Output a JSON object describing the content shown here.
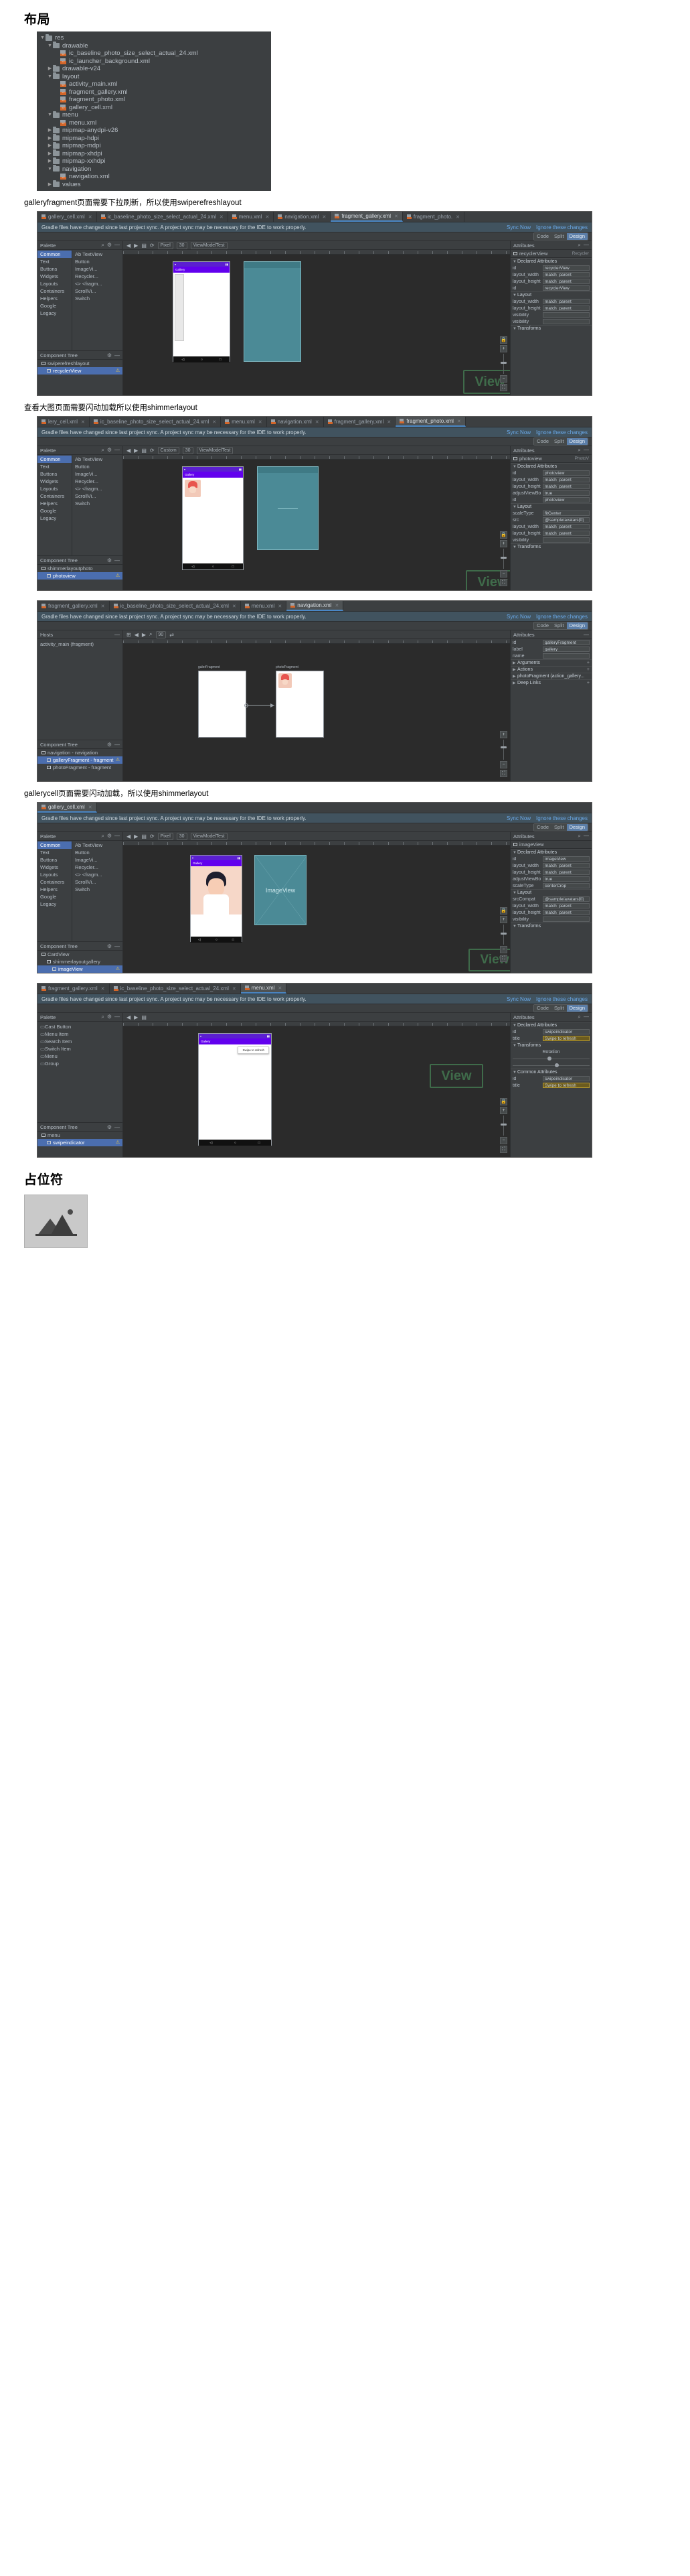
{
  "sections": {
    "layout_title": "布局",
    "caption1": "galleryfragment页面需要下拉刷新，所以使用swiperefreshlayout",
    "caption2": "查看大图页面需要闪动加载所以使用shimmerlayout",
    "caption3": "gallerycell页面需要闪动加载，所以使用shimmerlayout",
    "placeholder_title": "占位符"
  },
  "filetree": [
    {
      "depth": 0,
      "arrow": "▼",
      "icon": "folder-res",
      "label": "res"
    },
    {
      "depth": 1,
      "arrow": "▼",
      "icon": "folder",
      "label": "drawable"
    },
    {
      "depth": 2,
      "arrow": "",
      "icon": "xml",
      "label": "ic_baseline_photo_size_select_actual_24.xml"
    },
    {
      "depth": 2,
      "arrow": "",
      "icon": "xml",
      "label": "ic_launcher_background.xml"
    },
    {
      "depth": 1,
      "arrow": "▶",
      "icon": "folder",
      "label": "drawable-v24"
    },
    {
      "depth": 1,
      "arrow": "▼",
      "icon": "folder",
      "label": "layout"
    },
    {
      "depth": 2,
      "arrow": "",
      "icon": "xml",
      "label": "activity_main.xml"
    },
    {
      "depth": 2,
      "arrow": "",
      "icon": "xml",
      "label": "fragment_gallery.xml"
    },
    {
      "depth": 2,
      "arrow": "",
      "icon": "xml",
      "label": "fragment_photo.xml"
    },
    {
      "depth": 2,
      "arrow": "",
      "icon": "xml",
      "label": "gallery_cell.xml"
    },
    {
      "depth": 1,
      "arrow": "▼",
      "icon": "folder",
      "label": "menu"
    },
    {
      "depth": 2,
      "arrow": "",
      "icon": "xml",
      "label": "menu.xml"
    },
    {
      "depth": 1,
      "arrow": "▶",
      "icon": "folder",
      "label": "mipmap-anydpi-v26"
    },
    {
      "depth": 1,
      "arrow": "▶",
      "icon": "folder",
      "label": "mipmap-hdpi"
    },
    {
      "depth": 1,
      "arrow": "▶",
      "icon": "folder",
      "label": "mipmap-mdpi"
    },
    {
      "depth": 1,
      "arrow": "▶",
      "icon": "folder",
      "label": "mipmap-xhdpi"
    },
    {
      "depth": 1,
      "arrow": "▶",
      "icon": "folder",
      "label": "mipmap-xxhdpi"
    },
    {
      "depth": 1,
      "arrow": "▼",
      "icon": "folder",
      "label": "navigation"
    },
    {
      "depth": 2,
      "arrow": "",
      "icon": "xml",
      "label": "navigation.xml"
    },
    {
      "depth": 1,
      "arrow": "▶",
      "icon": "folder",
      "label": "values"
    }
  ],
  "common": {
    "sync_banner_text": "Gradle files have changed since last project sync. A project sync may be necessary for the IDE to work properly.",
    "sync_now": "Sync Now",
    "ignore_changes": "Ignore these changes",
    "code": "Code",
    "split": "Split",
    "design": "Design",
    "palette_title": "Palette",
    "component_tree_title": "Component Tree",
    "attributes_title": "Attributes",
    "declared_attributes": "Declared Attributes",
    "layout_group": "Layout",
    "transforms_group": "Transforms",
    "common_attributes": "Common Attributes",
    "palette_categories": [
      "Common",
      "Text",
      "Buttons",
      "Widgets",
      "Layouts",
      "Containers",
      "Helpers",
      "Google",
      "Legacy"
    ],
    "palette_items": [
      "Ab TextView",
      "Button",
      "ImageVi...",
      "Recycler...",
      "<> <fragm...",
      "ScrollVi...",
      "Switch"
    ],
    "view_watermark": "View"
  },
  "panel1": {
    "tabs": [
      {
        "label": "gallery_cell.xml",
        "active": false
      },
      {
        "label": "ic_baseline_photo_size_select_actual_24.xml",
        "active": false
      },
      {
        "label": "menu.xml",
        "active": false
      },
      {
        "label": "navigation.xml",
        "active": false
      },
      {
        "label": "fragment_gallery.xml",
        "active": true
      },
      {
        "label": "fragment_photo.",
        "active": false
      }
    ],
    "toolbar": {
      "device": "Pixel",
      "api": "30",
      "theme": "ViewModelTest"
    },
    "selected_component": "recyclerView",
    "component_tree": [
      {
        "label": "swiperefreshlayout",
        "sel": false,
        "depth": 0
      },
      {
        "label": "recyclerView",
        "sel": true,
        "depth": 1
      }
    ],
    "attr_header_name": "recyclerView",
    "attr_header_type": "Recycler",
    "attrs": [
      {
        "k": "id",
        "v": "recyclerView",
        "hl": false
      },
      {
        "k": "layout_width",
        "v": "match_parent",
        "hl": false
      },
      {
        "k": "layout_height",
        "v": "match_parent",
        "hl": false
      },
      {
        "k": "id",
        "v": "recyclerView",
        "hl": false
      },
      {
        "k": "layout_width",
        "v": "match_parent",
        "hl": false
      },
      {
        "k": "layout_height",
        "v": "match_parent",
        "hl": false
      },
      {
        "k": "visibility",
        "v": "",
        "hl": false
      },
      {
        "k": "visibility",
        "v": "",
        "hl": false
      }
    ],
    "phone_title": "Gallery",
    "blueprint_label": "View"
  },
  "panel2": {
    "tabs": [
      {
        "label": "lery_cell.xml",
        "active": false
      },
      {
        "label": "ic_baseline_photo_size_select_actual_24.xml",
        "active": false
      },
      {
        "label": "menu.xml",
        "active": false
      },
      {
        "label": "navigation.xml",
        "active": false
      },
      {
        "label": "fragment_gallery.xml",
        "active": false
      },
      {
        "label": "fragment_photo.xml",
        "active": true
      }
    ],
    "toolbar": {
      "device": "Custom",
      "api": "30",
      "theme": "ViewModelTest"
    },
    "selected_component": "photoview",
    "component_tree": [
      {
        "label": "shimmerlayoutphoto",
        "sel": false,
        "depth": 0
      },
      {
        "label": "photoview",
        "sel": true,
        "depth": 1
      }
    ],
    "attr_header_name": "photoview",
    "attr_header_type": "PhotoV",
    "attrs": [
      {
        "k": "id",
        "v": "photoview",
        "hl": false
      },
      {
        "k": "layout_width",
        "v": "match_parent",
        "hl": false
      },
      {
        "k": "layout_height",
        "v": "match_parent",
        "hl": false
      },
      {
        "k": "adjustViewBo...",
        "v": "true",
        "hl": false
      },
      {
        "k": "id",
        "v": "photoview",
        "hl": false
      },
      {
        "k": "scaleType",
        "v": "fitCenter",
        "hl": false
      },
      {
        "k": "src",
        "v": "@sample/avatars[0]",
        "hl": false
      },
      {
        "k": "layout_width",
        "v": "match_parent",
        "hl": false
      },
      {
        "k": "layout_height",
        "v": "match_parent",
        "hl": false
      },
      {
        "k": "visibility",
        "v": "",
        "hl": false
      }
    ],
    "phone_title": "Gallery",
    "blueprint_label": "View"
  },
  "panel3": {
    "tabs": [
      {
        "label": "fragment_gallery.xml",
        "active": false
      },
      {
        "label": "ic_baseline_photo_size_select_actual_24.xml",
        "active": false
      },
      {
        "label": "menu.xml",
        "active": false
      },
      {
        "label": "navigation.xml",
        "active": true
      }
    ],
    "hosts_title": "Hosts",
    "host_item": "activity_main (fragment)",
    "component_tree": [
      {
        "label": "navigation - navigation",
        "sel": false,
        "depth": 0
      },
      {
        "label": "galleryFragment - fragment",
        "sel": true,
        "depth": 1
      },
      {
        "label": "photoFragment - fragment",
        "sel": false,
        "depth": 1
      }
    ],
    "graph_nodes": [
      {
        "label": "galerFragment"
      },
      {
        "label": "photoFragment"
      }
    ],
    "attr_header_name": "galleryFragment",
    "attr_header_type": "Fragment",
    "attrs": [
      {
        "k": "id",
        "v": "galleryFragment",
        "hl": false
      },
      {
        "k": "label",
        "v": "gallery",
        "hl": false
      },
      {
        "k": "name",
        "v": "",
        "hl": false
      }
    ],
    "groups": [
      {
        "label": "Arguments",
        "plus": true
      },
      {
        "label": "Actions",
        "plus": true
      },
      {
        "label": "photoFragment  (action_gallery...",
        "plus": false
      },
      {
        "label": "Deep Links",
        "plus": true
      }
    ]
  },
  "panel4": {
    "tabs": [
      {
        "label": "gallery_cell.xml",
        "active": true
      }
    ],
    "toolbar": {
      "device": "Pixel",
      "api": "30",
      "theme": "ViewModelTest"
    },
    "selected_component": "imageView",
    "component_tree": [
      {
        "label": "CardView",
        "sel": false,
        "depth": 0
      },
      {
        "label": "shimmerlayoutgallery",
        "sel": false,
        "depth": 1
      },
      {
        "label": "imageView",
        "sel": true,
        "depth": 2
      }
    ],
    "attr_header_name": "imageView",
    "attr_header_type": "",
    "attrs": [
      {
        "k": "id",
        "v": "imageView",
        "hl": false
      },
      {
        "k": "layout_width",
        "v": "match_parent",
        "hl": false
      },
      {
        "k": "layout_height",
        "v": "match_parent",
        "hl": false
      },
      {
        "k": "adjustViewBo...",
        "v": "true",
        "hl": false
      },
      {
        "k": "scaleType",
        "v": "centerCrop",
        "hl": false
      },
      {
        "k": "srcCompat",
        "v": "@sample/avatars[0]",
        "hl": false
      },
      {
        "k": "layout_width",
        "v": "match_parent",
        "hl": false
      },
      {
        "k": "layout_height",
        "v": "match_parent",
        "hl": false
      },
      {
        "k": "visibility",
        "v": "",
        "hl": false
      }
    ],
    "blueprint_label": "ImageView",
    "watermark": "View"
  },
  "panel5": {
    "tabs": [
      {
        "label": "fragment_gallery.xml",
        "active": false
      },
      {
        "label": "ic_baseline_photo_size_select_actual_24.xml",
        "active": false
      },
      {
        "label": "menu.xml",
        "active": true
      }
    ],
    "palette_items": [
      "Cast Button",
      "Menu Item",
      "Search Item",
      "Switch Item",
      "Menu",
      "Group"
    ],
    "component_tree": [
      {
        "label": "menu",
        "sel": false,
        "depth": 0
      },
      {
        "label": "swipeindicator",
        "sel": true,
        "depth": 1
      }
    ],
    "attr_header_name": "swipeindicator",
    "attrs": [
      {
        "k": "id",
        "v": "swipeindicator",
        "hl": false
      },
      {
        "k": "title",
        "v": "Swipe to refresh",
        "hl": true
      }
    ],
    "common_attrs": [
      {
        "k": "id",
        "v": "swipeindicator",
        "hl": false
      },
      {
        "k": "title",
        "v": "Swipe to refresh",
        "hl": true
      }
    ],
    "rotation_label": "Rotation",
    "menu_item_label": "Swipe to refresh",
    "phone_title": "Gallery",
    "watermark": "View"
  }
}
